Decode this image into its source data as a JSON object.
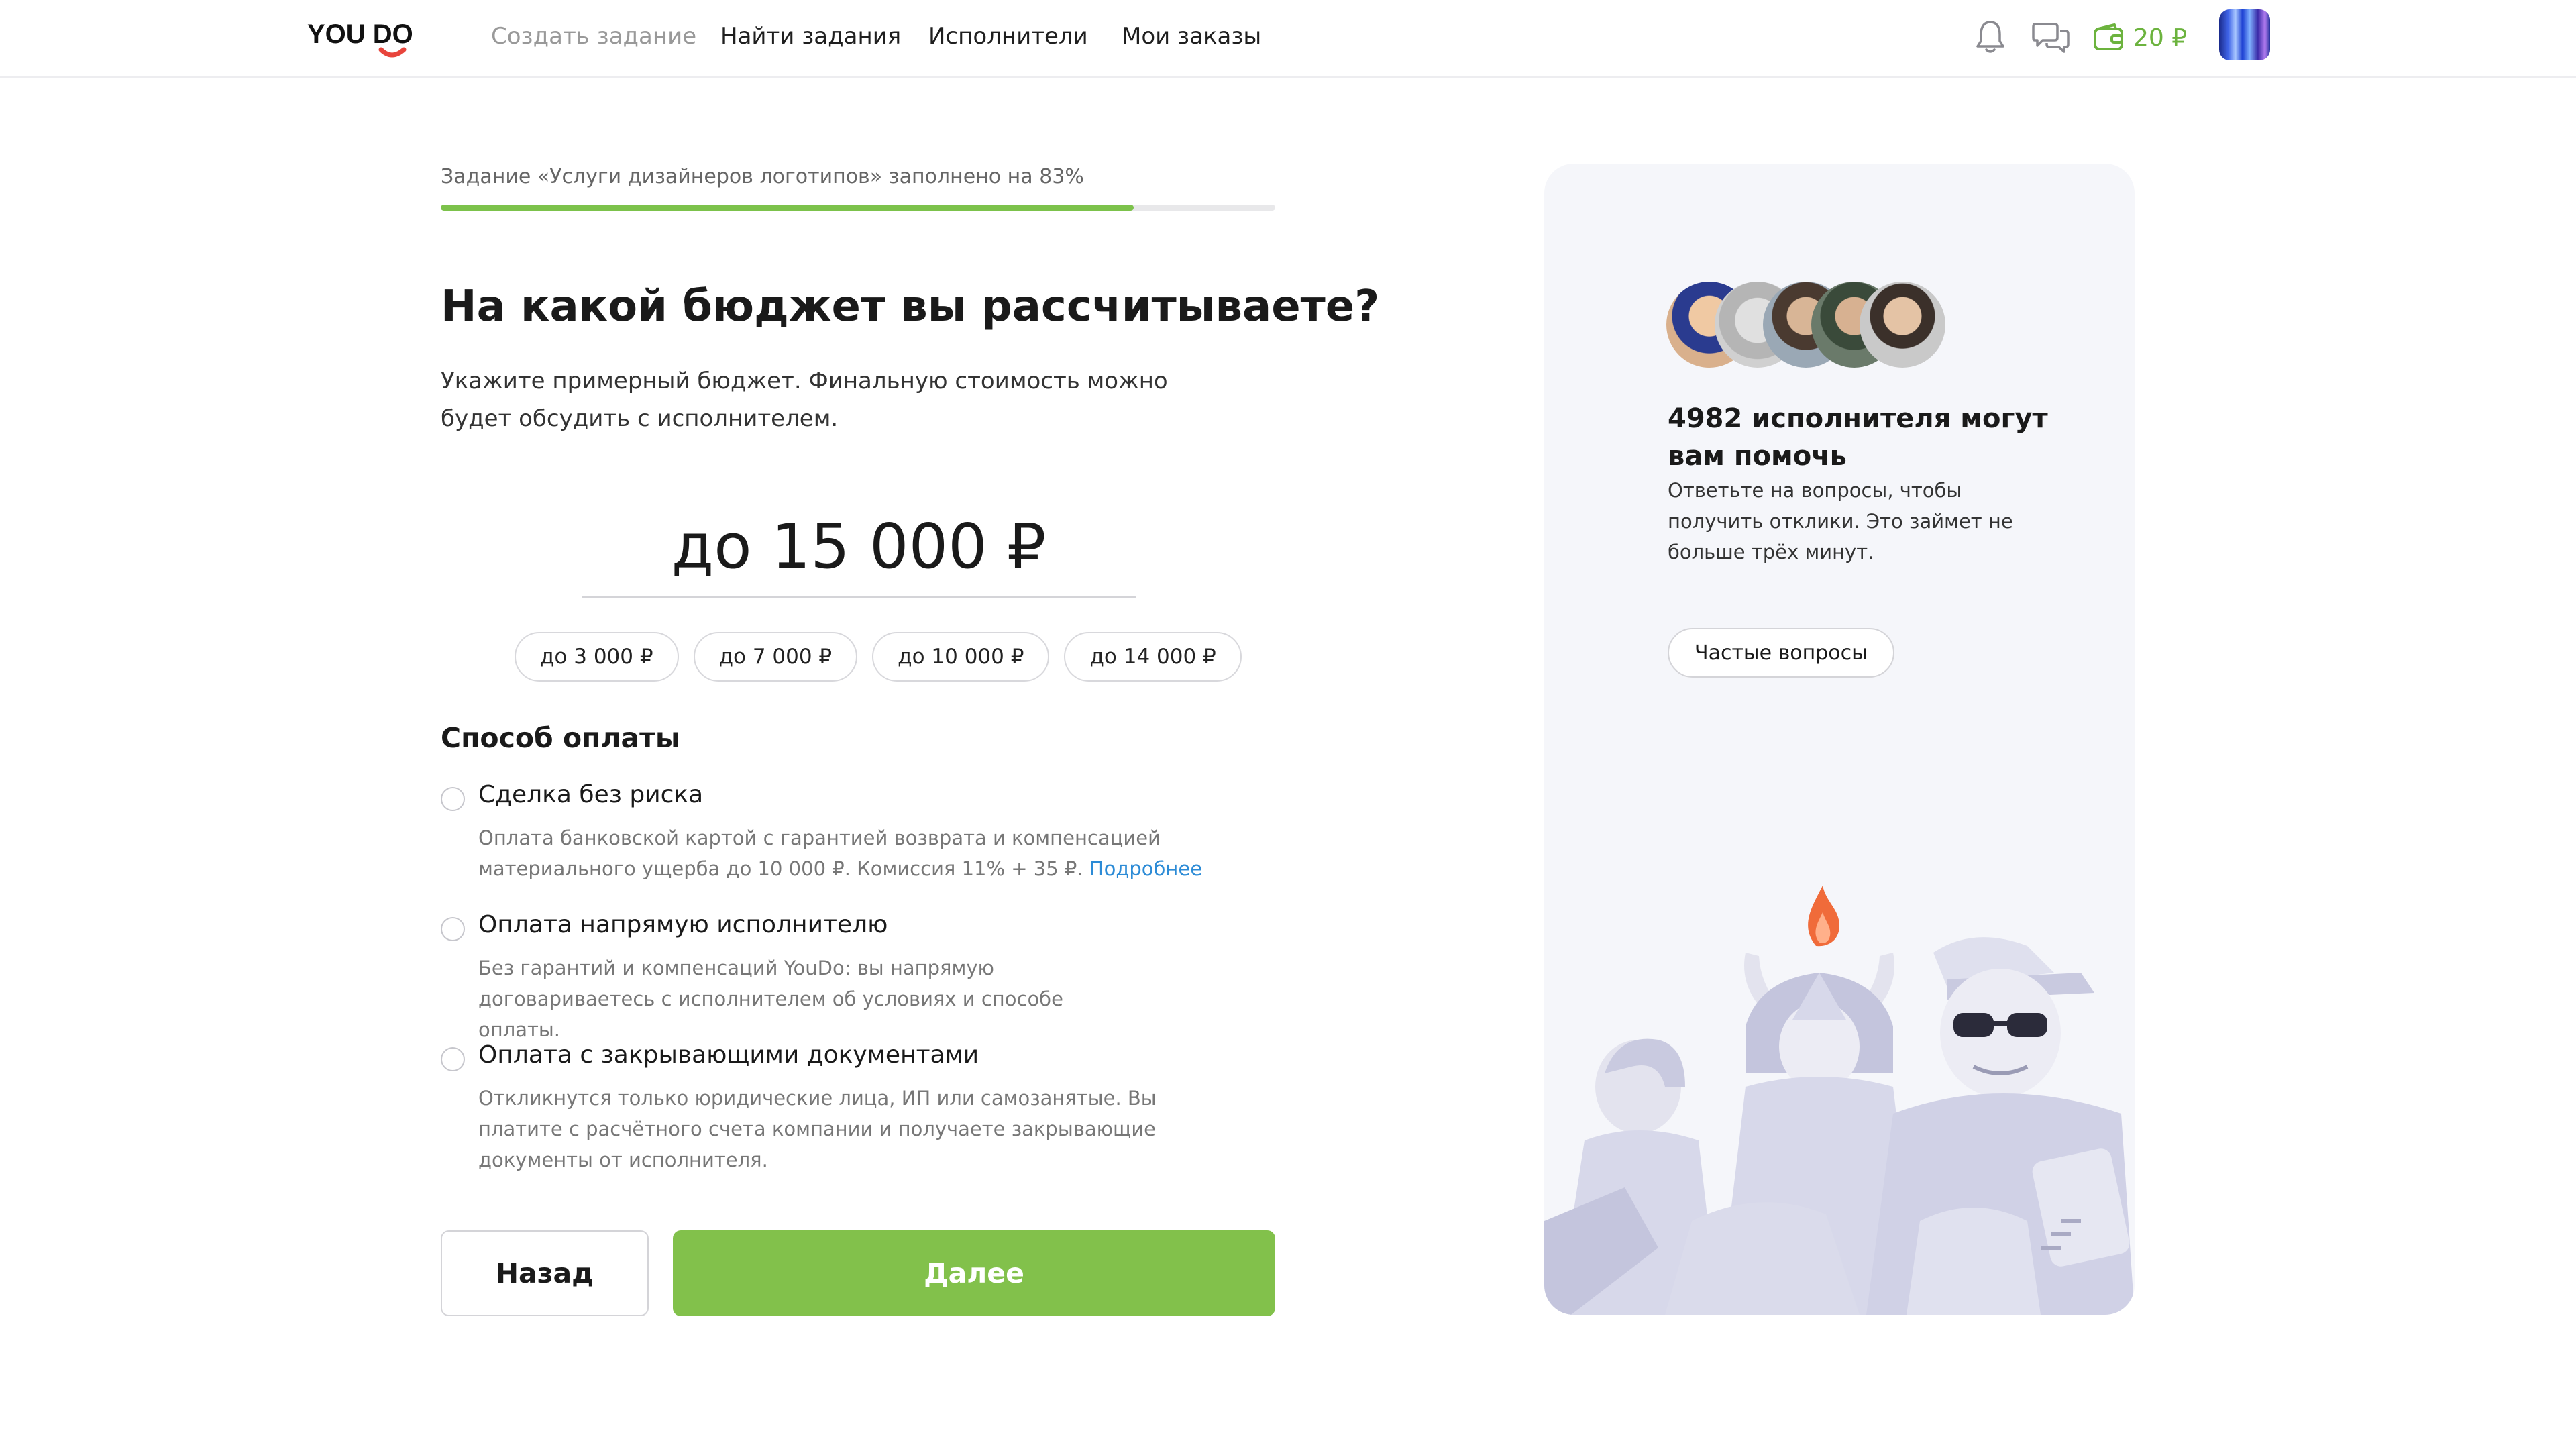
{
  "header": {
    "logo_text": "YOU DO",
    "nav": {
      "create": "Создать задание",
      "find": "Найти задания",
      "performers": "Исполнители",
      "orders": "Мои заказы"
    },
    "icons": {
      "notifications": "bell-icon",
      "messages": "chat-icon",
      "wallet": "wallet-icon"
    },
    "wallet_balance": "20 ₽"
  },
  "progress": {
    "label": "Задание «Услуги дизайнеров логотипов» заполнено на 83%",
    "percent": 83
  },
  "question": {
    "title": "На какой бюджет вы рассчитываете?",
    "description": "Укажите примерный бюджет. Финальную стоимость можно будет обсудить с исполнителем."
  },
  "budget": {
    "value": "до 15 000 ₽",
    "chips": [
      "до 3 000 ₽",
      "до 7 000 ₽",
      "до 10 000 ₽",
      "до 14 000 ₽"
    ]
  },
  "payment": {
    "title": "Способ оплаты",
    "options": [
      {
        "label": "Сделка без риска",
        "description": "Оплата банковской картой с гарантией возврата и компенсацией материального ущерба до 10 000 ₽. Комиссия 11% + 35 ₽.",
        "link": "Подробнее"
      },
      {
        "label": "Оплата напрямую исполнителю",
        "description": "Без гарантий и компенсаций YouDo: вы напрямую договариваетесь с исполнителем об условиях и способе оплаты."
      },
      {
        "label": "Оплата с закрывающими документами",
        "description": "Откликнутся только юридические лица, ИП или самозанятые. Вы платите с расчётного счета компании и получаете закрывающие документы от исполнителя."
      }
    ]
  },
  "buttons": {
    "back": "Назад",
    "next": "Далее"
  },
  "side": {
    "title": "4982 исполнителя могут вам помочь",
    "text": "Ответьте на вопросы, чтобы получить отклики. Это займет не больше трёх минут.",
    "faq_button": "Частые вопросы"
  },
  "colors": {
    "accent": "#82c14b",
    "progress": "#7cc24b",
    "link": "#2c8bd6",
    "wallet": "#6cb33e",
    "logo_smile": "#e8453c"
  }
}
